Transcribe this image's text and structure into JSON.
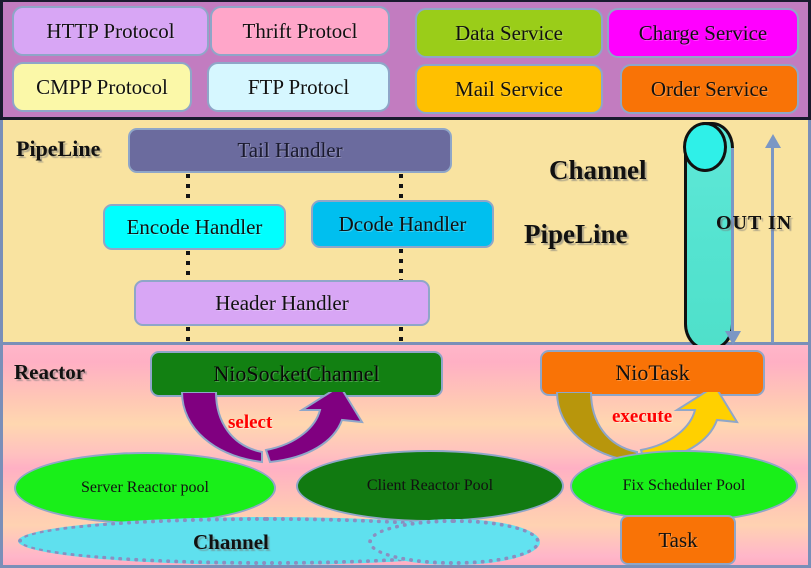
{
  "diagram": {
    "title": "Netty PipeLine / Reactor architecture diagram",
    "colors": {
      "protocol_band_bg": "#c27cc0",
      "pipeline_band_bg": "#f9e3a0",
      "reactor_band_gradient_start": "#ffb6c9",
      "reactor_band_gradient_mid": "#ffd7b0",
      "accent_red": "#ff0000",
      "arrow_blue": "#7b97c4",
      "select_arrow": "#800080",
      "execute_arrow": "#ffd000"
    }
  },
  "protocols": {
    "items": [
      {
        "label": "HTTP Protocol",
        "color": "#d8a6f5"
      },
      {
        "label": "Thrift Protocl",
        "color": "#ffa6c9"
      },
      {
        "label": "CMPP Protocol",
        "color": "#fbf8a8"
      },
      {
        "label": "FTP Protocl",
        "color": "#d6f7ff"
      }
    ]
  },
  "services": {
    "items": [
      {
        "label": "Data Service",
        "color": "#9acd19"
      },
      {
        "label": "Charge Service",
        "color": "#ff00ff"
      },
      {
        "label": "Mail Service",
        "color": "#ffc000"
      },
      {
        "label": "Order Service",
        "color": "#f97306"
      }
    ]
  },
  "pipeline": {
    "section_label": "PipeLine",
    "handlers": [
      {
        "label": "Tail Handler",
        "color": "#6b6b9e"
      },
      {
        "label": "Encode Handler",
        "color": "#00ffff"
      },
      {
        "label": "Dcode Handler",
        "color": "#00bfef"
      },
      {
        "label": "Header Handler",
        "color": "#d8a6f5"
      }
    ],
    "channel_label": "Channel",
    "channel_pipeline_label": "PipeLine",
    "direction_label": "OUT  IN",
    "direction_out": "OUT",
    "direction_in": "IN"
  },
  "reactor": {
    "section_label": "Reactor",
    "nio_socket_channel": "NioSocketChannel",
    "nio_task": "NioTask",
    "select_label": "select",
    "execute_label": "execute",
    "task_label": "Task",
    "pools": [
      {
        "label": "Server Reactor pool",
        "color": "#19ef19"
      },
      {
        "label": "Client Reactor Pool",
        "color": "#117a11"
      },
      {
        "label": "Fix Scheduler Pool",
        "color": "#19ef19"
      }
    ],
    "channel_ellipse_label": "Channel"
  }
}
